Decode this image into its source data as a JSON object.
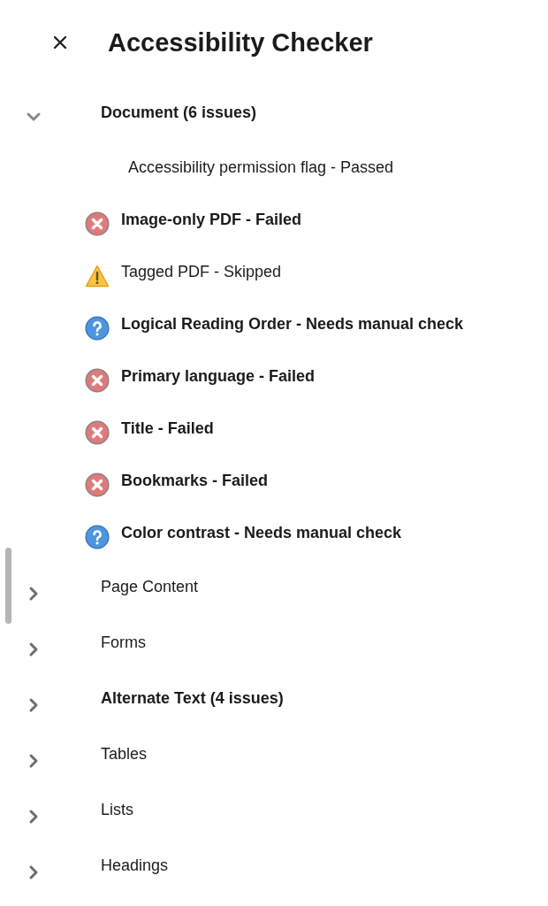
{
  "panel": {
    "title": "Accessibility Checker"
  },
  "categories": [
    {
      "label": "Document (6 issues)",
      "expanded": true,
      "has_issues": true,
      "children": [
        {
          "label": "Accessibility permission flag - Passed",
          "kind": "passed"
        },
        {
          "label": "Image-only PDF - Failed",
          "kind": "failed"
        },
        {
          "label": "Tagged PDF - Skipped",
          "kind": "skipped"
        },
        {
          "label": "Logical Reading Order - Needs manual check",
          "kind": "manual"
        },
        {
          "label": "Primary language - Failed",
          "kind": "failed"
        },
        {
          "label": "Title - Failed",
          "kind": "failed"
        },
        {
          "label": "Bookmarks - Failed",
          "kind": "failed"
        },
        {
          "label": "Color contrast - Needs manual check",
          "kind": "manual"
        }
      ]
    },
    {
      "label": "Page Content",
      "expanded": false,
      "has_issues": false
    },
    {
      "label": "Forms",
      "expanded": false,
      "has_issues": false
    },
    {
      "label": "Alternate Text (4 issues)",
      "expanded": false,
      "has_issues": true
    },
    {
      "label": "Tables",
      "expanded": false,
      "has_issues": false
    },
    {
      "label": "Lists",
      "expanded": false,
      "has_issues": false
    },
    {
      "label": "Headings",
      "expanded": false,
      "has_issues": false
    }
  ]
}
